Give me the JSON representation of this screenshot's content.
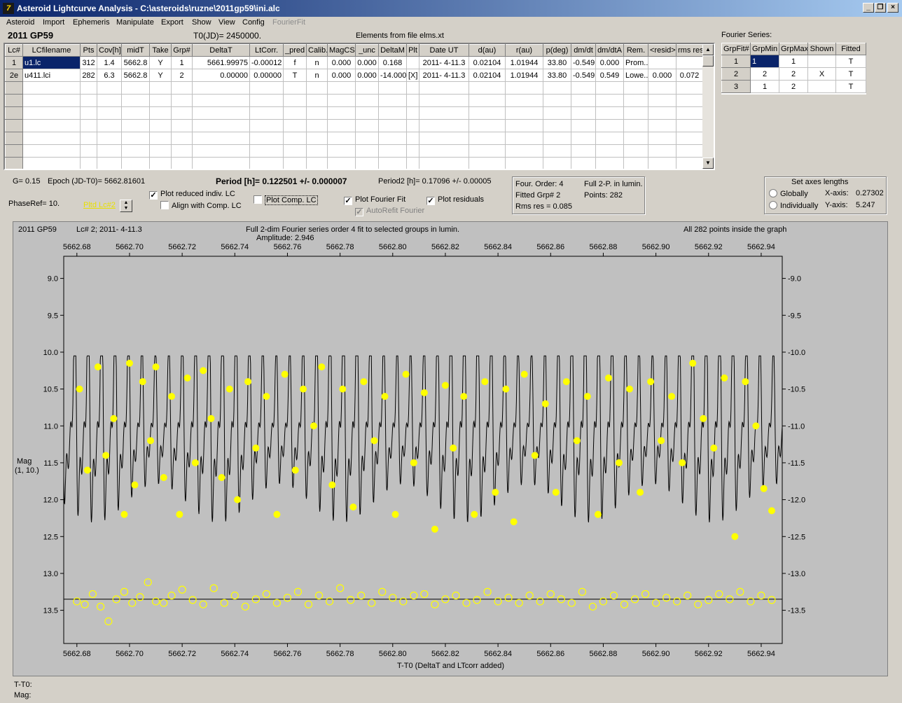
{
  "window": {
    "title": "Asteroid Lightcurve Analysis - C:\\asteroids\\ruzne\\2011gp59\\ini.alc",
    "icon_glyph": "7",
    "buttons": {
      "minimize": "_",
      "restore": "❐",
      "close": "×"
    }
  },
  "menu": [
    "Asteroid",
    "Import",
    "Ephemeris",
    "Manipulate",
    "Export",
    "Show",
    "View",
    "Config",
    "FourierFit"
  ],
  "header": {
    "asteroid_name": "2011 GP59",
    "t0": "T0(JD)= 2450000.",
    "elements_file": "Elements from file elms.xt"
  },
  "lc_table": {
    "columns": [
      "Lc#",
      "LCfilename",
      "Pts",
      "Cov[h]",
      "midT",
      "Take",
      "Grp#",
      "DeltaT",
      "LtCorr.",
      "_pred",
      "Calib.",
      "MagCS",
      "_unc",
      "DeltaM",
      "Plt",
      "Date UT",
      "d(au)",
      "r(au)",
      "p(deg)",
      "dm/dt",
      "dm/dtA",
      "Rem.",
      "<resid>",
      "rms res"
    ],
    "rows": [
      [
        "1",
        "u1.lc",
        "312",
        "1.4",
        "5662.8",
        "Y",
        "1",
        "5661.99975",
        "-0.00012",
        "f",
        "n",
        "0.000",
        "0.000",
        "0.168",
        "",
        "2011- 4-11.3",
        "0.02104",
        "1.01944",
        "33.80",
        "-0.549",
        "0.000",
        "Prom...",
        "",
        ""
      ],
      [
        "2e",
        "u411.lci",
        "282",
        "6.3",
        "5662.8",
        "Y",
        "2",
        "0.00000",
        "0.00000",
        "T",
        "n",
        "0.000",
        "0.000",
        "-14.000",
        "[X]",
        "2011- 4-11.3",
        "0.02104",
        "1.01944",
        "33.80",
        "-0.549",
        "0.549",
        "Lowe..",
        "0.000",
        "0.072"
      ]
    ]
  },
  "fourier_table": {
    "title": "Fourier Series:",
    "columns": [
      "GrpFit#",
      "GrpMin",
      "GrpMax",
      "Shown",
      "Fitted"
    ],
    "rows": [
      [
        "1",
        "1",
        "1",
        "",
        "T"
      ],
      [
        "2",
        "2",
        "2",
        "X",
        "T"
      ],
      [
        "3",
        "1",
        "2",
        "",
        "T"
      ]
    ]
  },
  "info": {
    "g": "G= 0.15",
    "epoch": "Epoch (JD-T0)= 5662.81601",
    "period": "Period [h]= 0.122501  +/-  0.000007",
    "period2": "Period2 [h]= 0.17096 +/- 0.00005",
    "phase_ref": "PhaseRef= 10.",
    "plot_lc": "Pltd Lc#2"
  },
  "options": {
    "plot_reduced": {
      "label": "Plot reduced indiv. LC",
      "checked": true
    },
    "align_comp": {
      "label": "Align with Comp. LC",
      "checked": false
    },
    "plot_comp": {
      "label": "Plot Comp. LC",
      "checked": false
    },
    "plot_fourier": {
      "label": "Plot Fourier Fit",
      "checked": true
    },
    "auto_refit": {
      "label": "AutoRefit Fourier",
      "checked": true
    },
    "plot_residuals": {
      "label": "Plot residuals",
      "checked": true
    },
    "check_mark": "✓"
  },
  "fit_info": {
    "order": "Four. Order:  4",
    "fitted_grp": "Fitted Grp# 2",
    "rms": "Rms res      = 0.085",
    "mode": "Full 2-P. in lumin.",
    "points": "Points: 282"
  },
  "axes_box": {
    "title": "Set axes lengths",
    "globally": "Globally",
    "individually": "Individually",
    "x_label": "X-axis:",
    "x_value": "0.27302",
    "y_label": "Y-axis:",
    "y_value": "5.247"
  },
  "plot": {
    "object": "2011 GP59",
    "lc_info": "Lc# 2; 2011- 4-11.3",
    "fit_desc": "Full 2-dim Fourier series order 4 fit to selected groups in lumin.",
    "amplitude": "Amplitude: 2.946",
    "points_note": "All 282 points inside the graph",
    "ylabel_line1": "Mag",
    "ylabel_line2": "(1, 10.)",
    "xlabel": "T-T0 (DeltaT and LTcorr added)"
  },
  "status": {
    "t_t0": "T-T0:",
    "mag": "Mag:"
  },
  "colors": {
    "points": "#ffff00",
    "background": "#c0c0c0",
    "fit_line": "#000000",
    "title_bar": "#0a246a"
  },
  "chart_data": {
    "type": "scatter",
    "xlim": [
      5662.675,
      5662.948
    ],
    "ylim": [
      13.95,
      8.7
    ],
    "y_reversed": true,
    "grid": false,
    "xticks": [
      "5662.68",
      "5662.70",
      "5662.72",
      "5662.74",
      "5662.76",
      "5662.78",
      "5662.80",
      "5662.82",
      "5662.84",
      "5662.86",
      "5662.88",
      "5662.90",
      "5662.92",
      "5662.94"
    ],
    "yticks": [
      "9.0",
      "9.5",
      "10.0",
      "10.5",
      "11.0",
      "11.5",
      "12.0",
      "12.5",
      "13.0",
      "13.5"
    ],
    "series": [
      {
        "kind": "observations",
        "x": [
          5662.681,
          5662.684,
          5662.688,
          5662.691,
          5662.694,
          5662.698,
          5662.7,
          5662.702,
          5662.705,
          5662.708,
          5662.71,
          5662.713,
          5662.716,
          5662.719,
          5662.722,
          5662.725,
          5662.728,
          5662.731,
          5662.735,
          5662.738,
          5662.741,
          5662.745,
          5662.748,
          5662.752,
          5662.756,
          5662.759,
          5662.763,
          5662.766,
          5662.77,
          5662.773,
          5662.777,
          5662.781,
          5662.785,
          5662.789,
          5662.793,
          5662.797,
          5662.801,
          5662.805,
          5662.808,
          5662.812,
          5662.816,
          5662.82,
          5662.823,
          5662.827,
          5662.831,
          5662.835,
          5662.839,
          5662.843,
          5662.846,
          5662.85,
          5662.854,
          5662.858,
          5662.862,
          5662.866,
          5662.87,
          5662.874,
          5662.878,
          5662.882,
          5662.886,
          5662.89,
          5662.894,
          5662.898,
          5662.902,
          5662.906,
          5662.91,
          5662.914,
          5662.918,
          5662.922,
          5662.926,
          5662.93,
          5662.934,
          5662.938,
          5662.941,
          5662.944
        ],
        "y": [
          10.5,
          11.6,
          10.2,
          11.4,
          10.9,
          12.2,
          10.15,
          11.8,
          10.4,
          11.2,
          10.2,
          11.7,
          10.6,
          12.2,
          10.35,
          11.5,
          10.25,
          10.9,
          11.7,
          10.5,
          12.0,
          10.4,
          11.3,
          10.6,
          12.2,
          10.3,
          11.6,
          10.5,
          11.0,
          10.2,
          11.8,
          10.5,
          12.1,
          10.4,
          11.2,
          10.6,
          12.2,
          10.3,
          11.5,
          10.55,
          12.4,
          10.45,
          11.3,
          10.6,
          12.2,
          10.4,
          11.9,
          10.5,
          12.3,
          10.3,
          11.4,
          10.7,
          11.9,
          10.4,
          11.2,
          10.6,
          12.2,
          10.35,
          11.5,
          10.5,
          11.9,
          10.4,
          11.2,
          10.6,
          11.5,
          10.15,
          10.9,
          11.3,
          10.35,
          12.5,
          10.4,
          11.0,
          11.85,
          12.15
        ]
      },
      {
        "kind": "residuals",
        "x": [
          5662.68,
          5662.683,
          5662.686,
          5662.689,
          5662.692,
          5662.695,
          5662.698,
          5662.701,
          5662.704,
          5662.707,
          5662.71,
          5662.713,
          5662.716,
          5662.72,
          5662.724,
          5662.728,
          5662.732,
          5662.736,
          5662.74,
          5662.744,
          5662.748,
          5662.752,
          5662.756,
          5662.76,
          5662.764,
          5662.768,
          5662.772,
          5662.776,
          5662.78,
          5662.784,
          5662.788,
          5662.792,
          5662.796,
          5662.8,
          5662.804,
          5662.808,
          5662.812,
          5662.816,
          5662.82,
          5662.824,
          5662.828,
          5662.832,
          5662.836,
          5662.84,
          5662.844,
          5662.848,
          5662.852,
          5662.856,
          5662.86,
          5662.864,
          5662.868,
          5662.872,
          5662.876,
          5662.88,
          5662.884,
          5662.888,
          5662.892,
          5662.896,
          5662.9,
          5662.904,
          5662.908,
          5662.912,
          5662.916,
          5662.92,
          5662.924,
          5662.928,
          5662.932,
          5662.936,
          5662.94,
          5662.944
        ],
        "y": [
          13.38,
          13.42,
          13.28,
          13.45,
          13.65,
          13.35,
          13.25,
          13.4,
          13.32,
          13.12,
          13.38,
          13.4,
          13.3,
          13.22,
          13.36,
          13.42,
          13.2,
          13.4,
          13.3,
          13.45,
          13.35,
          13.28,
          13.4,
          13.33,
          13.25,
          13.42,
          13.3,
          13.38,
          13.2,
          13.36,
          13.3,
          13.4,
          13.25,
          13.33,
          13.38,
          13.3,
          13.28,
          13.42,
          13.35,
          13.3,
          13.4,
          13.36,
          13.25,
          13.38,
          13.33,
          13.4,
          13.3,
          13.38,
          13.28,
          13.35,
          13.4,
          13.25,
          13.45,
          13.38,
          13.3,
          13.42,
          13.35,
          13.28,
          13.4,
          13.33,
          13.38,
          13.3,
          13.42,
          13.36,
          13.28,
          13.35,
          13.25,
          13.38,
          13.3,
          13.36
        ]
      },
      {
        "kind": "fourier_fit",
        "period_days": 0.00510421,
        "amplitude": 2.946,
        "mean_mag": 11.0
      }
    ],
    "residual_zero_line": 13.35
  }
}
